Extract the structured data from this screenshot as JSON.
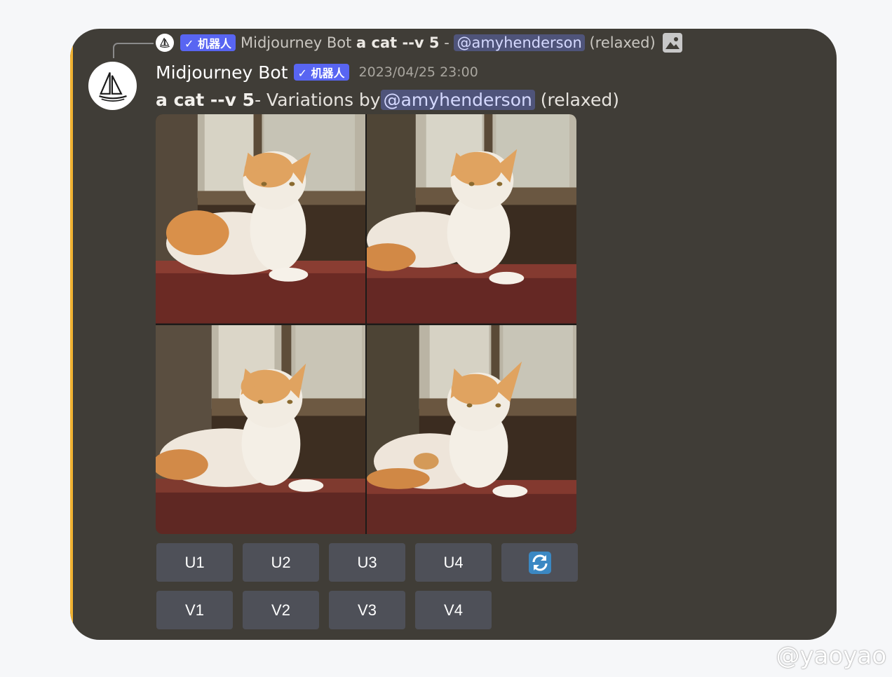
{
  "reply": {
    "badge": "✓ 机器人",
    "author": "Midjourney Bot",
    "prompt": "a cat --v 5",
    "separator": " - ",
    "mention": "@amyhenderson",
    "mode": "(relaxed)"
  },
  "message": {
    "author": "Midjourney Bot",
    "badge": "✓ 机器人",
    "timestamp": "2023/04/25 23:00",
    "prompt": "a cat --v 5",
    "middle": " - Variations by ",
    "mention": "@amyhenderson",
    "mode": "(relaxed)"
  },
  "images": [
    {
      "name": "cat-variation-1"
    },
    {
      "name": "cat-variation-2"
    },
    {
      "name": "cat-variation-3"
    },
    {
      "name": "cat-variation-4"
    }
  ],
  "buttons": {
    "upscale": [
      "U1",
      "U2",
      "U3",
      "U4"
    ],
    "variation": [
      "V1",
      "V2",
      "V3",
      "V4"
    ],
    "reroll_icon": "refresh-icon"
  },
  "watermark": "@yaoyao",
  "colors": {
    "card_bg": "#403d37",
    "accent_bar": "#f0b232",
    "badge": "#5865f2",
    "mention_bg": "#4f547a",
    "button_bg": "#4e5058",
    "reroll_blue": "#3b88c3"
  }
}
